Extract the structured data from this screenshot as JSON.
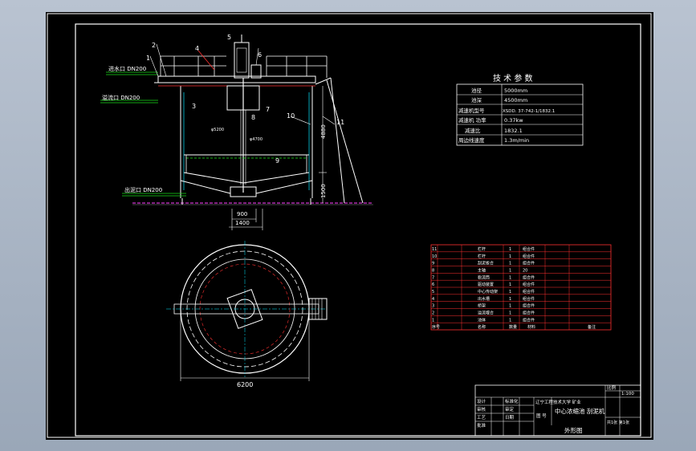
{
  "drawing": {
    "tech_params": {
      "title": "技 术 参 数",
      "rows": [
        {
          "label": "池径",
          "value": "5000mm"
        },
        {
          "label": "池深",
          "value": "4500mm"
        },
        {
          "label": "减速机型号",
          "value": "XSDD. 37-742-1/1832.1"
        },
        {
          "label": "减速机 功率",
          "value": "0.37kw"
        },
        {
          "label": "减速比",
          "value": "1832.1"
        },
        {
          "label": "周边线速度",
          "value": "1.3m/min"
        }
      ]
    },
    "ports": {
      "inlet": "进水口 DN200",
      "overflow": "溢流口 DN200",
      "outlet": "出泥口 DN200"
    },
    "part_numbers": [
      "1",
      "2",
      "3",
      "4",
      "5",
      "6",
      "7",
      "8",
      "9",
      "10",
      "11"
    ],
    "dimensions": {
      "height": "4880",
      "low_height": "1500",
      "d900": "900",
      "d1400": "1400",
      "plan_diameter": "6200",
      "phi1": "φ5200",
      "phi2": "φ4700"
    },
    "parts_list": {
      "rows": [
        {
          "no": "11",
          "name": "栏杆",
          "qty": "1",
          "material": "组合件"
        },
        {
          "no": "10",
          "name": "栏杆",
          "qty": "1",
          "material": "组合件"
        },
        {
          "no": "9",
          "name": "刮泥板合",
          "qty": "1",
          "material": "组合件"
        },
        {
          "no": "8",
          "name": "主轴",
          "qty": "1",
          "material": "20"
        },
        {
          "no": "7",
          "name": "稳流筒",
          "qty": "1",
          "material": "组合件"
        },
        {
          "no": "6",
          "name": "驱动装置",
          "qty": "1",
          "material": "组合件"
        },
        {
          "no": "5",
          "name": "中心传动架",
          "qty": "1",
          "material": "组合件"
        },
        {
          "no": "4",
          "name": "出水槽",
          "qty": "1",
          "material": "组合件"
        },
        {
          "no": "3",
          "name": "桥架",
          "qty": "1",
          "material": "组合件"
        },
        {
          "no": "2",
          "name": "溢流堰合",
          "qty": "1",
          "material": "组合件"
        },
        {
          "no": "1",
          "name": "池体",
          "qty": "1",
          "material": "组合件"
        }
      ],
      "header": [
        "序号",
        "名称",
        "数量",
        "材料",
        "备注"
      ]
    },
    "title_block": {
      "school": "辽宁工程技术大学 矿业",
      "title_line1": "中心浓缩池 刮泥机",
      "title_line2": "外形图",
      "labels_left": [
        "设计",
        "审核",
        "工艺",
        "批准"
      ],
      "labels_mid": [
        "标准化",
        "审定",
        "日期"
      ],
      "scale_label": "比例",
      "scale": "1:100",
      "sheet": "共1张 第1张",
      "mark": "图 号"
    }
  },
  "colors": {
    "background": "#000000",
    "line_white": "#ffffff",
    "line_red": "#ff3030",
    "line_green": "#18e018",
    "line_cyan": "#00e6ff",
    "line_magenta": "#ff40ff",
    "line_yellow": "#ffff40"
  }
}
